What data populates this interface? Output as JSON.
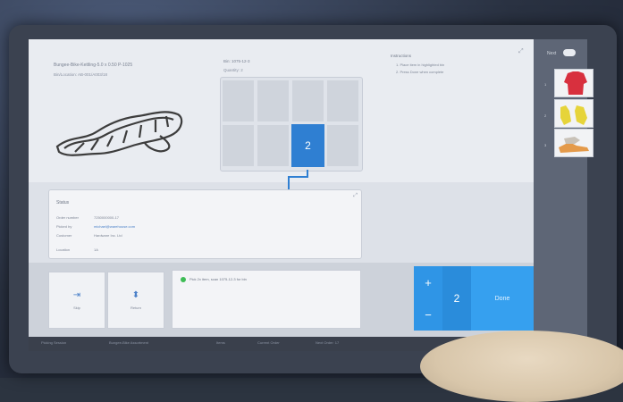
{
  "item": {
    "title": "Bungee-Bike-Kettling-5.0 x 0.50 P-1025",
    "subtitle": "Bin/Location: AB-001/A003/18"
  },
  "location": {
    "label": "Bin: 1075-12-3",
    "sub": "Quantity: 2"
  },
  "grid": {
    "active_value": "2"
  },
  "instructions": {
    "title": "Instructions",
    "lines": [
      "1. Place item in highlighted bin",
      "2. Press Done when complete"
    ]
  },
  "status": {
    "title": "Status",
    "rows": [
      {
        "label": "Order number",
        "value": "7250000000-17"
      },
      {
        "label": "Picked by",
        "value": "michael@warehouse.com"
      },
      {
        "label": "Customer",
        "value": "Hardware Inc. Ltd"
      },
      {
        "label": "Location",
        "value": "1A"
      }
    ]
  },
  "actions": [
    {
      "icon": "⇥",
      "label": "Skip",
      "name": "skip-button"
    },
    {
      "icon": "⬍",
      "label": "Return",
      "name": "return-button"
    }
  ],
  "message": "Pick 2x item, scan 1075-12-3 for bin",
  "quantity": {
    "plus": "+",
    "minus": "−",
    "value": "2",
    "done": "Done"
  },
  "rightbar": {
    "title": "Next",
    "nums": [
      "1",
      "2",
      "3"
    ]
  },
  "bottombar": [
    "Picking Session",
    "Bungee-Bike Assortment",
    "Items",
    "Current Order",
    "Next Order: 17"
  ]
}
